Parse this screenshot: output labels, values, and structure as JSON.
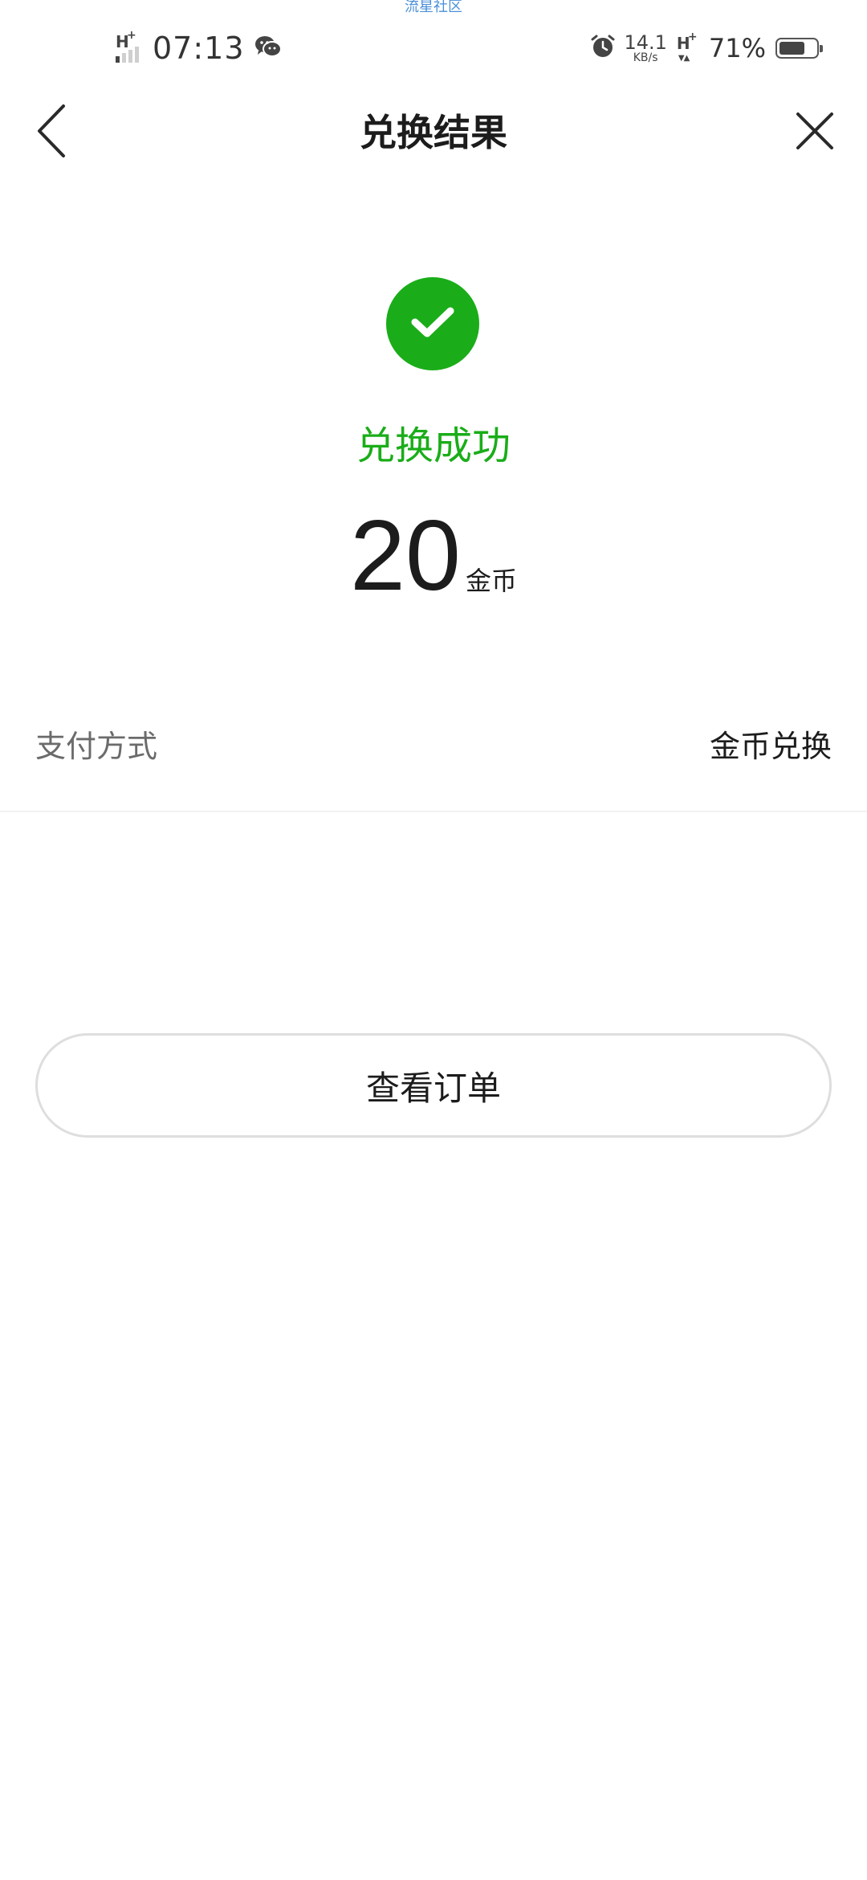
{
  "watermark": "流星社区",
  "status_bar": {
    "network_type": "H",
    "network_plus": "+",
    "time": "07:13",
    "app_icon": "wechat-icon",
    "alarm_icon": "alarm-icon",
    "speed_value": "14.1",
    "speed_unit": "KB/s",
    "network_type_2": "H",
    "network_plus_2": "+",
    "battery_percent": "71%",
    "battery_level": 0.71
  },
  "header": {
    "title": "兑换结果",
    "back_icon": "chevron-left-icon",
    "close_icon": "close-icon"
  },
  "result": {
    "status_icon": "checkmark-icon",
    "status_text": "兑换成功",
    "amount": "20",
    "amount_unit": "金币"
  },
  "payment": {
    "label": "支付方式",
    "value": "金币兑换"
  },
  "actions": {
    "view_order_label": "查看订单"
  },
  "colors": {
    "success_green": "#1aad19",
    "text_primary": "#1c1c1c",
    "text_secondary": "#6b6b6b",
    "button_border": "#dedede",
    "watermark_blue": "#4a90d9"
  }
}
